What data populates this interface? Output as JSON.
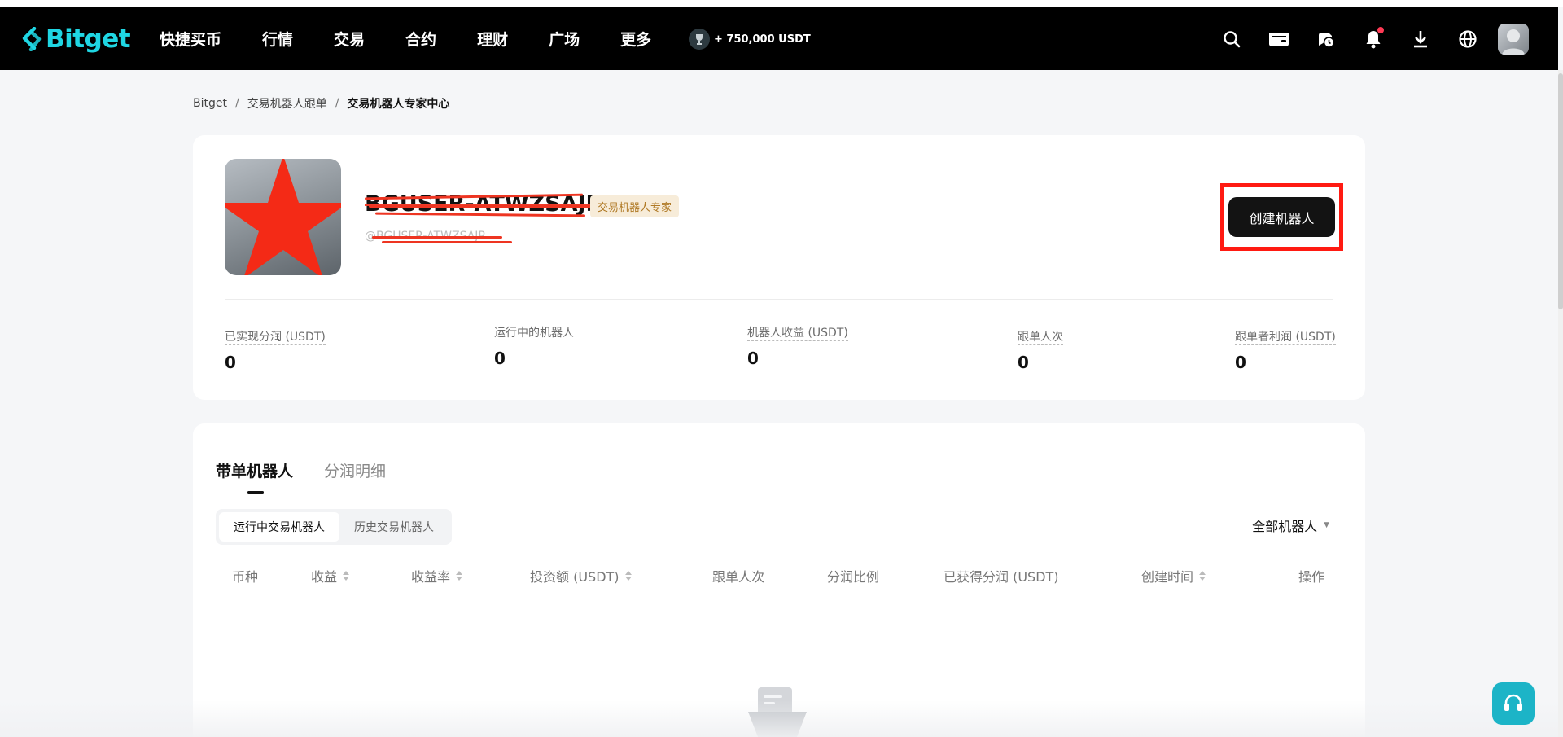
{
  "brand": {
    "name": "Bitget",
    "accent": "#1fd6e3"
  },
  "nav": {
    "items": [
      "快捷买币",
      "行情",
      "交易",
      "合约",
      "理财",
      "广场",
      "更多"
    ],
    "promo": "+ 750,000 USDT",
    "icons": [
      "search-icon",
      "wallet-icon",
      "history-icon",
      "bell-icon",
      "download-icon",
      "globe-icon",
      "user-avatar"
    ],
    "notification_dot_color": "#ff3a55"
  },
  "breadcrumb": {
    "root": "Bitget",
    "sep": "/",
    "level1": "交易机器人跟单",
    "current": "交易机器人专家中心"
  },
  "profile": {
    "username": "BGUSER-ATWZSAJR",
    "badge": "交易机器人专家",
    "handle": "@BGUSER-ATWZSAJR",
    "create_button": "创建机器人"
  },
  "stats": [
    {
      "label": "已实现分润 (USDT)",
      "value": "0"
    },
    {
      "label": "运行中的机器人",
      "value": "0"
    },
    {
      "label": "机器人收益 (USDT)",
      "value": "0"
    },
    {
      "label": "跟单人次",
      "value": "0"
    },
    {
      "label": "跟单者利润 (USDT)",
      "value": "0"
    }
  ],
  "tabs": {
    "active": "带单机器人",
    "other": "分润明细"
  },
  "segments": {
    "running": "运行中交易机器人",
    "history": "历史交易机器人"
  },
  "filter": {
    "label": "全部机器人"
  },
  "table": {
    "columns": [
      "币种",
      "收益",
      "收益率",
      "投资额 (USDT)",
      "跟单人次",
      "分润比例",
      "已获得分润 (USDT)",
      "创建时间",
      "操作"
    ]
  },
  "colors": {
    "highlight_frame": "#ff1a12",
    "support_button": "#1cb4c7"
  }
}
